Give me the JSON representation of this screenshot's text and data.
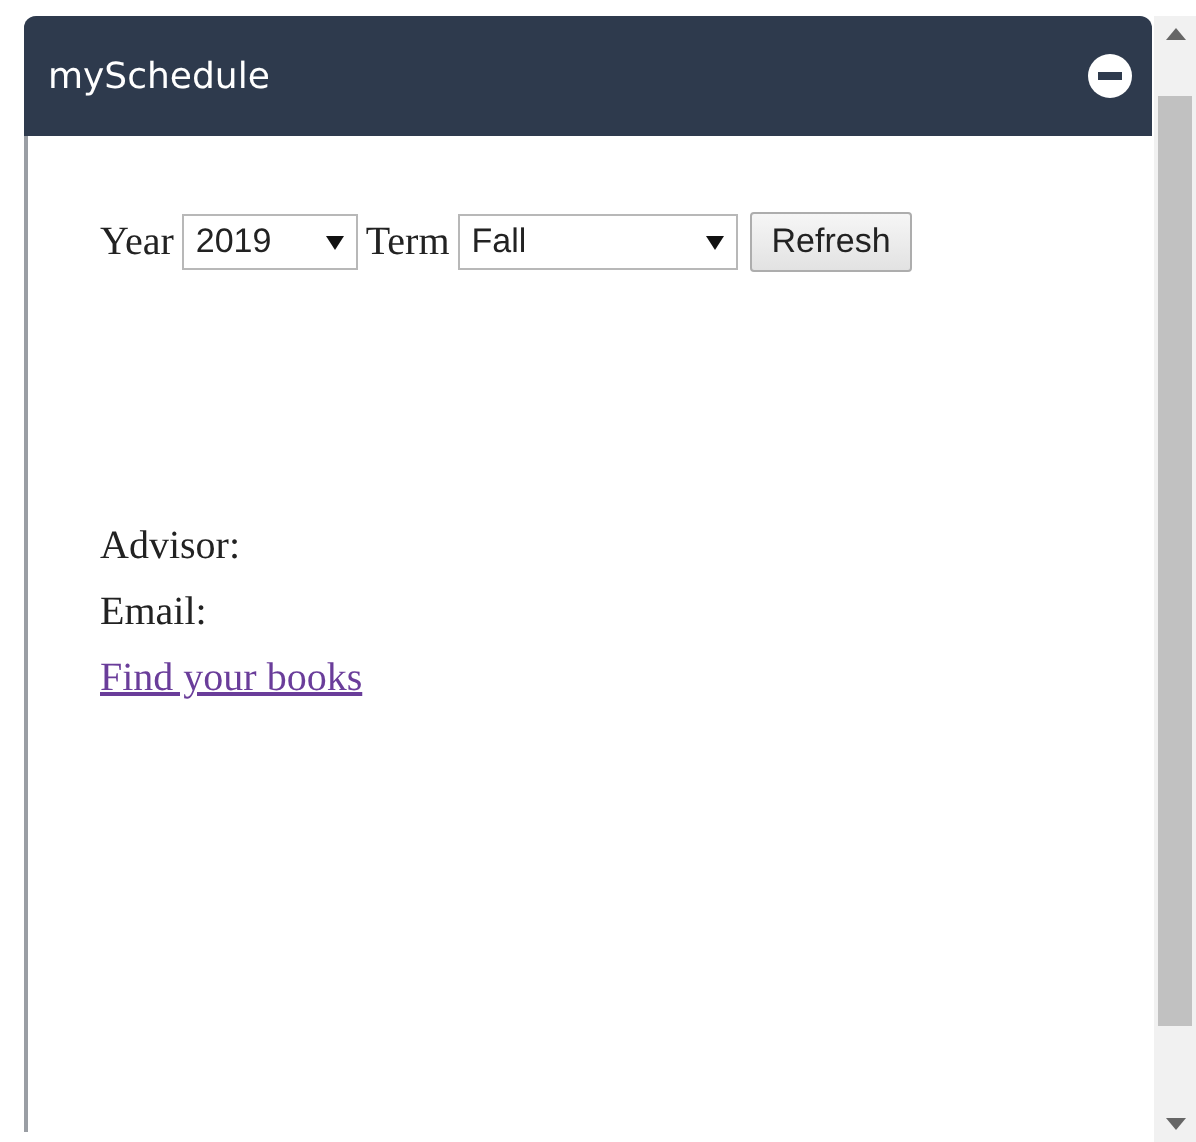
{
  "panel": {
    "title": "mySchedule"
  },
  "filters": {
    "year_label": "Year",
    "year": "2019",
    "term_label": "Term",
    "term": "Fall",
    "refresh": "Refresh"
  },
  "info": {
    "advisor": "Advisor:",
    "email": "Email:",
    "books_link": "Find your books"
  }
}
